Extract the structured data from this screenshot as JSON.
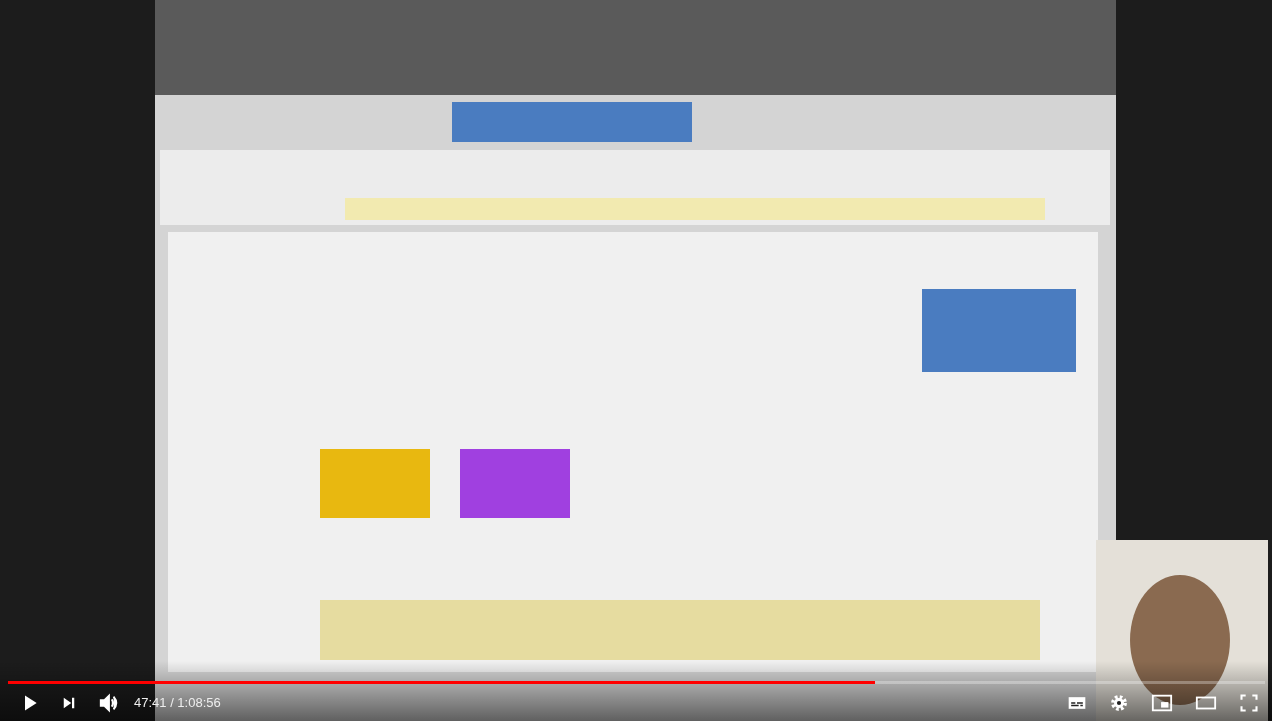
{
  "player": {
    "progress": {
      "level": 0.69
    },
    "time": "47:41 / 1:08:56"
  }
}
